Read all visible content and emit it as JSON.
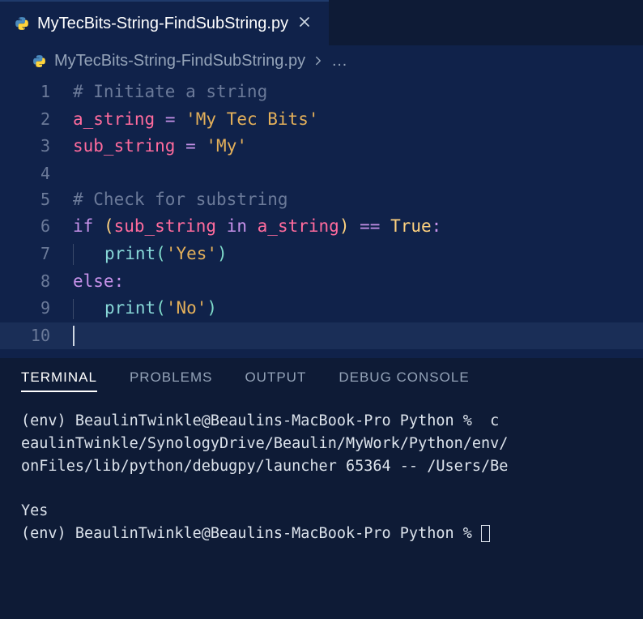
{
  "tab": {
    "title": "MyTecBits-String-FindSubString.py",
    "icon": "python-icon"
  },
  "breadcrumb": {
    "file": "MyTecBits-String-FindSubString.py",
    "more": "…"
  },
  "code": {
    "lines": [
      {
        "n": "1",
        "tokens": [
          {
            "t": "# Initiate a string",
            "c": "tok-comment"
          }
        ]
      },
      {
        "n": "2",
        "tokens": [
          {
            "t": "a_string",
            "c": "tok-ident-red"
          },
          {
            "t": " "
          },
          {
            "t": "=",
            "c": "tok-op"
          },
          {
            "t": " "
          },
          {
            "t": "'My Tec Bits'",
            "c": "tok-string"
          }
        ]
      },
      {
        "n": "3",
        "tokens": [
          {
            "t": "sub_string",
            "c": "tok-ident-red"
          },
          {
            "t": " "
          },
          {
            "t": "=",
            "c": "tok-op"
          },
          {
            "t": " "
          },
          {
            "t": "'My'",
            "c": "tok-string"
          }
        ]
      },
      {
        "n": "4",
        "tokens": []
      },
      {
        "n": "5",
        "tokens": [
          {
            "t": "# Check for substring",
            "c": "tok-comment"
          }
        ]
      },
      {
        "n": "6",
        "tokens": [
          {
            "t": "if",
            "c": "tok-kw"
          },
          {
            "t": " "
          },
          {
            "t": "(",
            "c": "tok-punct"
          },
          {
            "t": "sub_string",
            "c": "tok-ident-red"
          },
          {
            "t": " "
          },
          {
            "t": "in",
            "c": "tok-kw"
          },
          {
            "t": " "
          },
          {
            "t": "a_string",
            "c": "tok-ident-red"
          },
          {
            "t": ")",
            "c": "tok-punct"
          },
          {
            "t": " "
          },
          {
            "t": "==",
            "c": "tok-op"
          },
          {
            "t": " "
          },
          {
            "t": "True",
            "c": "tok-const"
          },
          {
            "t": ":",
            "c": "tok-op"
          }
        ]
      },
      {
        "n": "7",
        "indent": true,
        "tokens": [
          {
            "t": "print",
            "c": "tok-builtin"
          },
          {
            "t": "(",
            "c": "tok-paren-green"
          },
          {
            "t": "'Yes'",
            "c": "tok-string"
          },
          {
            "t": ")",
            "c": "tok-paren-green"
          }
        ]
      },
      {
        "n": "8",
        "tokens": [
          {
            "t": "else",
            "c": "tok-kw"
          },
          {
            "t": ":",
            "c": "tok-op"
          }
        ]
      },
      {
        "n": "9",
        "indent": true,
        "tokens": [
          {
            "t": "print",
            "c": "tok-builtin"
          },
          {
            "t": "(",
            "c": "tok-paren-green"
          },
          {
            "t": "'No'",
            "c": "tok-string"
          },
          {
            "t": ")",
            "c": "tok-paren-green"
          }
        ]
      },
      {
        "n": "10",
        "highlight": true,
        "caret": true,
        "tokens": []
      }
    ]
  },
  "panel": {
    "tabs": [
      {
        "label": "TERMINAL",
        "active": true
      },
      {
        "label": "PROBLEMS",
        "active": false
      },
      {
        "label": "OUTPUT",
        "active": false
      },
      {
        "label": "DEBUG CONSOLE",
        "active": false
      }
    ],
    "terminal_lines": [
      "(env) BeaulinTwinkle@Beaulins-MacBook-Pro Python %  c",
      "eaulinTwinkle/SynologyDrive/Beaulin/MyWork/Python/env/",
      "onFiles/lib/python/debugpy/launcher 65364 -- /Users/Be",
      "",
      "Yes"
    ],
    "prompt": "(env) BeaulinTwinkle@Beaulins-MacBook-Pro Python % "
  }
}
